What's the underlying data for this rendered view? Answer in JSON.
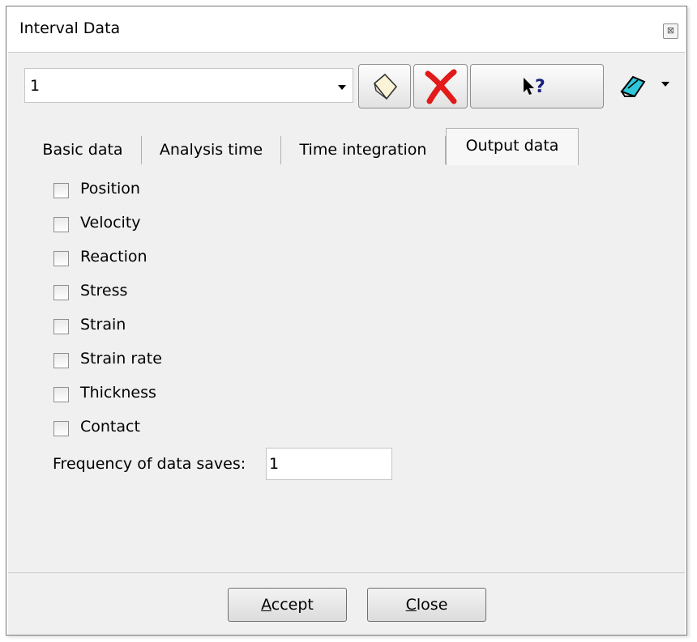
{
  "window": {
    "title": "Interval Data",
    "close_glyph": "⊠"
  },
  "toolbar": {
    "interval_value": "1",
    "buttons": [
      {
        "name": "new-interval-button",
        "icon": "new-sheet-icon"
      },
      {
        "name": "delete-interval-button",
        "icon": "red-x-icon"
      },
      {
        "name": "help-button",
        "icon": "whats-this-help-icon"
      },
      {
        "name": "edit-button",
        "icon": "eraser-icon"
      }
    ]
  },
  "tabs": [
    {
      "label": "Basic data",
      "active": false
    },
    {
      "label": "Analysis time",
      "active": false
    },
    {
      "label": "Time integration",
      "active": false
    },
    {
      "label": "Output data",
      "active": true
    }
  ],
  "output_options": [
    {
      "label": "Position",
      "checked": false
    },
    {
      "label": "Velocity",
      "checked": false
    },
    {
      "label": "Reaction",
      "checked": false
    },
    {
      "label": "Stress",
      "checked": false
    },
    {
      "label": "Strain",
      "checked": false
    },
    {
      "label": "Strain rate",
      "checked": false
    },
    {
      "label": "Thickness",
      "checked": false
    },
    {
      "label": "Contact",
      "checked": false
    }
  ],
  "frequency": {
    "label": "Frequency of data saves:",
    "value": "1"
  },
  "footer": {
    "accept_mnemonic": "A",
    "accept_rest": "ccept",
    "close_mnemonic": "C",
    "close_rest": "lose"
  },
  "colors": {
    "delete_red": "#e21a1a",
    "help_blue": "#1a237e",
    "eraser_cyan": "#2ec6d8"
  }
}
